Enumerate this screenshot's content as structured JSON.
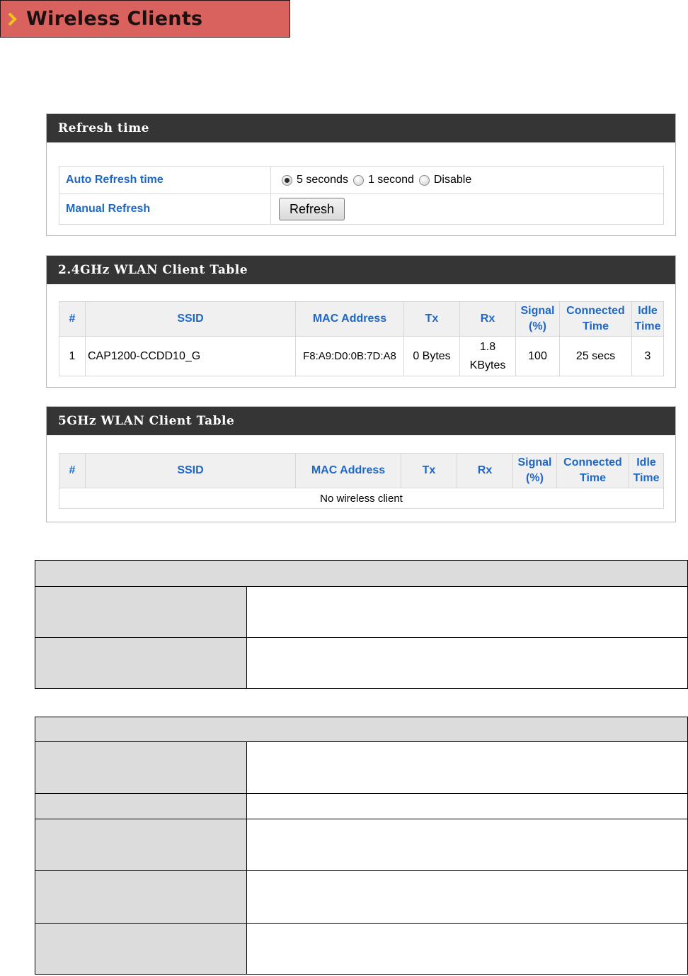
{
  "page_title": "Wireless Clients",
  "refresh_panel": {
    "title": "Refresh time",
    "auto_refresh_label": "Auto Refresh time",
    "options": [
      "5 seconds",
      "1 second",
      "Disable"
    ],
    "selected_option": "5 seconds",
    "manual_refresh_label": "Manual Refresh",
    "refresh_button": "Refresh"
  },
  "columns": [
    "#",
    "SSID",
    "MAC Address",
    "Tx",
    "Rx",
    "Signal (%)",
    "Connected Time",
    "Idle Time"
  ],
  "wlan24": {
    "title": "2.4GHz WLAN Client Table",
    "rows": [
      {
        "num": "1",
        "ssid": "CAP1200-CCDD10_G",
        "mac": "F8:A9:D0:0B:7D:A8",
        "tx": "0 Bytes",
        "rx": "1.8 KBytes",
        "signal": "100",
        "connected": "25 secs",
        "idle": "3"
      }
    ]
  },
  "wlan5": {
    "title": "5GHz WLAN Client Table",
    "empty_text": "No wireless client"
  }
}
